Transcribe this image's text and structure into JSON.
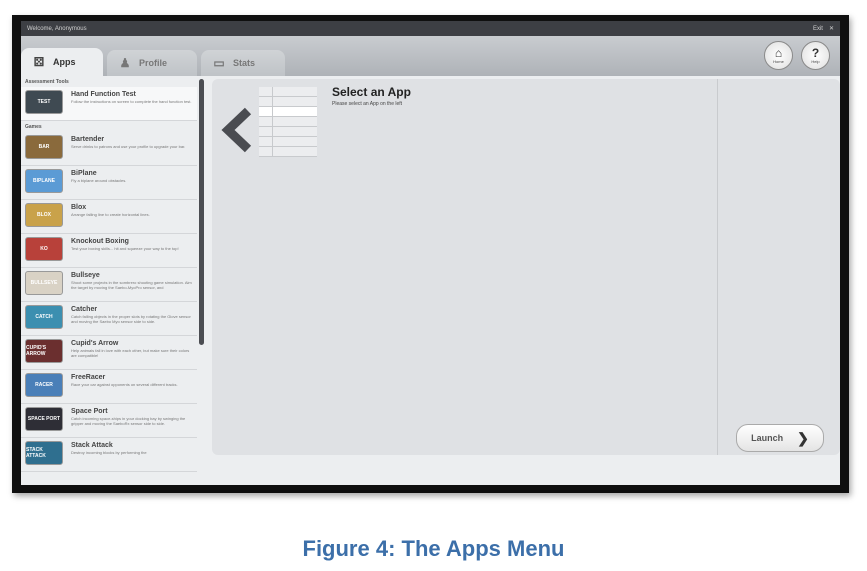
{
  "window": {
    "title": "Welcome, Anonymous",
    "exit_label": "Exit"
  },
  "tabs": [
    {
      "label": "Apps",
      "icon": "dice-icon"
    },
    {
      "label": "Profile",
      "icon": "person-icon"
    },
    {
      "label": "Stats",
      "icon": "chart-icon"
    }
  ],
  "header_buttons": {
    "home": {
      "label": "Home",
      "glyph": "⌂"
    },
    "help": {
      "label": "Help",
      "glyph": "?"
    }
  },
  "sidebar": {
    "assessment_header": "Assessment Tools",
    "games_header": "Games",
    "assessment": [
      {
        "name": "Hand Function Test",
        "desc": "Follow the instructions on screen to complete the hand function test.",
        "thumb_text": "TEST",
        "color": "#3f4a52"
      }
    ],
    "games": [
      {
        "name": "Bartender",
        "desc": "Serve drinks to patrons and use your profile to upgrade your bar.",
        "thumb_text": "BAR",
        "color": "#8a6a3c"
      },
      {
        "name": "BiPlane",
        "desc": "Fly a biplane around obstacles.",
        "thumb_text": "BIPLANE",
        "color": "#5b9bd5"
      },
      {
        "name": "Blox",
        "desc": "Arrange falling line to create horizontal lines.",
        "thumb_text": "BLOX",
        "color": "#c9a24a"
      },
      {
        "name": "Knockout Boxing",
        "desc": "Test your boxing skills... hit and squeeze your way to the top!",
        "thumb_text": "KO",
        "color": "#b8413a"
      },
      {
        "name": "Bullseye",
        "desc": "Shoot some projects in the sombrero shooting game simulation. Aim the target by moving the Saebo-MyoPro sensor, and",
        "thumb_text": "BULLSEYE",
        "color": "#d9d2c5"
      },
      {
        "name": "Catcher",
        "desc": "Catch falling objects in the proper slots by rotating the Glove sensor and moving the Saebo Myo sensor side to side.",
        "thumb_text": "CATCH",
        "color": "#3c8fb0"
      },
      {
        "name": "Cupid's Arrow",
        "desc": "Help animals fall in love with each other, but make sure their colors are compatible!",
        "thumb_text": "CUPID'S ARROW",
        "color": "#6b2f2f"
      },
      {
        "name": "FreeRacer",
        "desc": "Race your car against opponents on several different tracks.",
        "thumb_text": "RACER",
        "color": "#4a7fb8"
      },
      {
        "name": "Space Port",
        "desc": "Catch incoming space-ships in your docking bay by swinging the gripper and moving the SaeboRx sensor side to side.",
        "thumb_text": "SPACE PORT",
        "color": "#2e2e36"
      },
      {
        "name": "Stack Attack",
        "desc": "Destroy incoming blocks by performing the",
        "thumb_text": "STACK ATTACK",
        "color": "#2f6f8f"
      }
    ]
  },
  "main": {
    "title": "Select an App",
    "subtitle": "Please select an App on the left",
    "launch_label": "Launch"
  },
  "caption": "Figure 4: The Apps Menu"
}
